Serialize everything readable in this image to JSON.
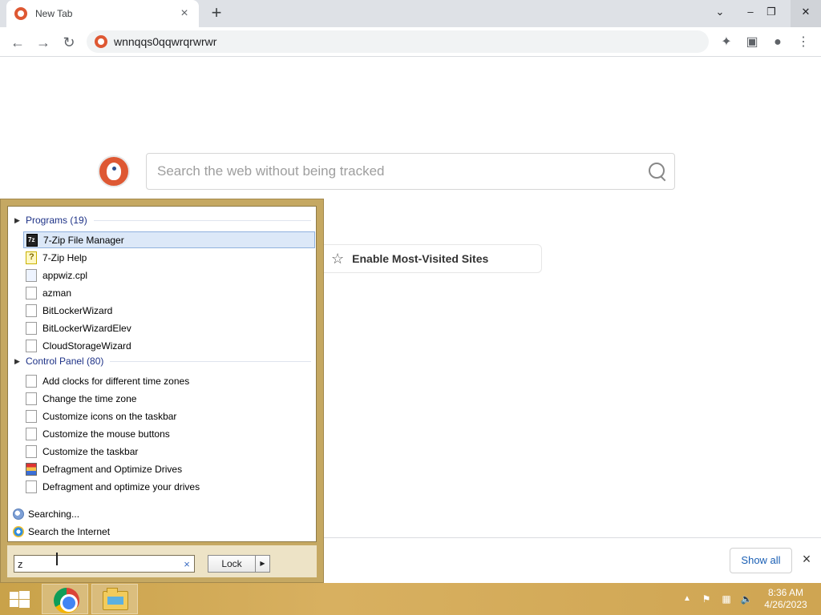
{
  "browser": {
    "tab_title": "New Tab",
    "tab_close": "×",
    "new_tab": "+",
    "address": "wnnqqs0qqwrqrwrwr"
  },
  "ddg": {
    "search_placeholder": "Search the web without being tracked",
    "most_visited_label": "Enable Most-Visited Sites",
    "show_all": "Show all",
    "close": "×"
  },
  "startmenu": {
    "groups": [
      {
        "label": "Programs (19)"
      },
      {
        "label": "Control Panel (80)"
      }
    ],
    "programs": [
      {
        "label": "7-Zip File Manager",
        "icon": "7zip-icon"
      },
      {
        "label": "7-Zip Help",
        "icon": "help-file-icon"
      },
      {
        "label": "appwiz.cpl",
        "icon": "cpl-file-icon"
      },
      {
        "label": "azman",
        "icon": "file-icon"
      },
      {
        "label": "BitLockerWizard",
        "icon": "file-icon"
      },
      {
        "label": "BitLockerWizardElev",
        "icon": "file-icon"
      },
      {
        "label": "CloudStorageWizard",
        "icon": "file-icon"
      }
    ],
    "control_panel": [
      {
        "label": "Add clocks for different time zones",
        "icon": "file-icon"
      },
      {
        "label": "Change the time zone",
        "icon": "file-icon"
      },
      {
        "label": "Customize icons on the taskbar",
        "icon": "file-icon"
      },
      {
        "label": "Customize the mouse buttons",
        "icon": "file-icon"
      },
      {
        "label": "Customize the taskbar",
        "icon": "file-icon"
      },
      {
        "label": "Defragment and Optimize Drives",
        "icon": "defrag-icon"
      },
      {
        "label": "Defragment and optimize your drives",
        "icon": "file-icon"
      }
    ],
    "searching": "Searching...",
    "search_internet": "Search the Internet",
    "search_value": "z",
    "clear": "×",
    "lock_label": "Lock"
  },
  "taskbar": {
    "time": "8:36 AM",
    "date": "4/26/2023"
  },
  "colors": {
    "accent_gold": "#c5a862",
    "ddg_orange": "#de5833",
    "selection": "#dce8f8"
  }
}
